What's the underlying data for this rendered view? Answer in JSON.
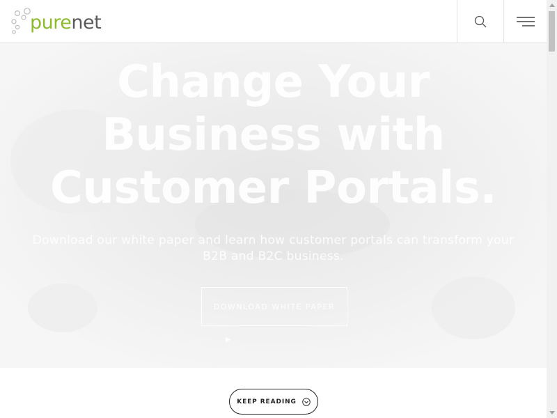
{
  "header": {
    "logo": {
      "text_pure": "pure",
      "text_net": "net"
    },
    "search_icon": "search-icon",
    "menu_icon": "hamburger-menu-icon"
  },
  "hero": {
    "title": "Change Your Business with Customer Portals.",
    "subtitle": "Download our white paper and learn how customer portals can transform your B2B and B2C business.",
    "cta_label": "DOWNLOAD WHITE PAPER",
    "indicator": "▶"
  },
  "keep_reading": {
    "label": "KEEP READING",
    "icon": "chevron-down-circle-icon"
  },
  "colors": {
    "brand_green": "#8dbb2d",
    "logo_gray": "#5a5a5a",
    "border": "#e3e3e3"
  }
}
